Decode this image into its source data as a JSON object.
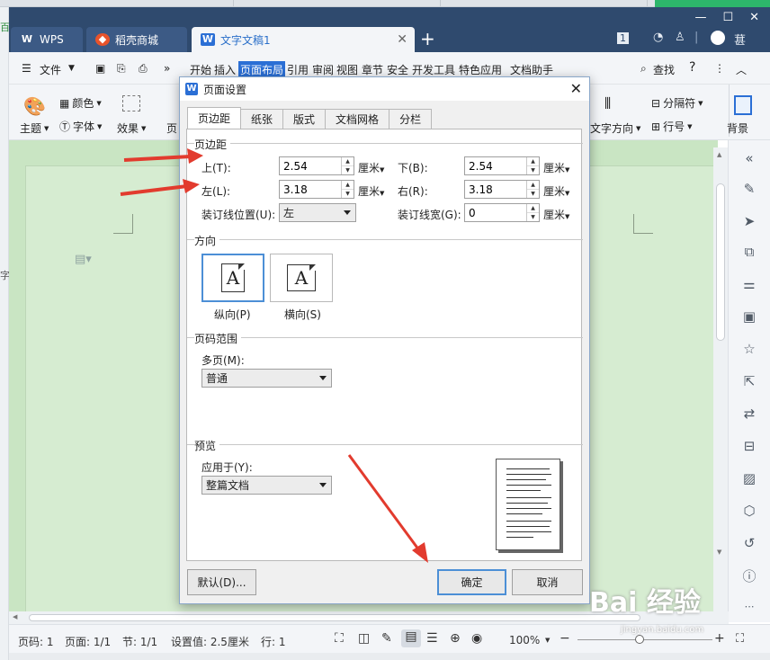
{
  "window": {
    "tabs": [
      {
        "label": "WPS"
      },
      {
        "label": "稻壳商城"
      },
      {
        "label": "文字文稿1"
      }
    ],
    "new_tab": "+",
    "badge": "1",
    "user_label": "葚"
  },
  "menubar": {
    "file": "文件",
    "items": [
      "开始",
      "插入",
      "页面布局",
      "引用",
      "审阅",
      "视图",
      "章节",
      "安全",
      "开发工具",
      "特色应用",
      "文档助手"
    ],
    "search": "查找",
    "help": "?"
  },
  "ribbon": {
    "theme": "主题",
    "color": "颜色",
    "font": "字体",
    "effect": "效果",
    "page": "页",
    "separator": "分隔符",
    "text_direction": "文字方向",
    "line_number": "行号",
    "background": "背景"
  },
  "left_edge": {
    "top": "百",
    "char": "字"
  },
  "dialog": {
    "title": "页面设置",
    "tabs": [
      "页边距",
      "纸张",
      "版式",
      "文档网格",
      "分栏"
    ],
    "margins": {
      "section": "页边距",
      "top_label": "上(T):",
      "top_value": "2.54",
      "bottom_label": "下(B):",
      "bottom_value": "2.54",
      "left_label": "左(L):",
      "left_value": "3.18",
      "right_label": "右(R):",
      "right_value": "3.18",
      "unit": "厘米",
      "gutter_pos_label": "装订线位置(U):",
      "gutter_pos_value": "左",
      "gutter_width_label": "装订线宽(G):",
      "gutter_width_value": "0"
    },
    "orientation": {
      "section": "方向",
      "portrait": "纵向(P)",
      "landscape": "横向(S)",
      "icon_glyph": "A"
    },
    "page_range": {
      "section": "页码范围",
      "multi_label": "多页(M):",
      "multi_value": "普通"
    },
    "preview": {
      "section": "预览",
      "apply_label": "应用于(Y):",
      "apply_value": "整篇文档"
    },
    "buttons": {
      "default": "默认(D)...",
      "ok": "确定",
      "cancel": "取消"
    }
  },
  "statusbar": {
    "page_no": "页码: 1",
    "pages": "页面: 1/1",
    "section": "节: 1/1",
    "setting": "设置值: 2.5厘米",
    "row": "行: 1",
    "zoom": "100%",
    "zoom_out": "−",
    "zoom_in": "+"
  },
  "watermark": {
    "text": "Bai 经验",
    "sub": "jingyan.baidu.com"
  },
  "colors": {
    "titlebar": "#2f4a6e",
    "accent": "#2b6fd5",
    "doc_bg": "#c9e5c3",
    "arrow": "#e23b2e"
  }
}
